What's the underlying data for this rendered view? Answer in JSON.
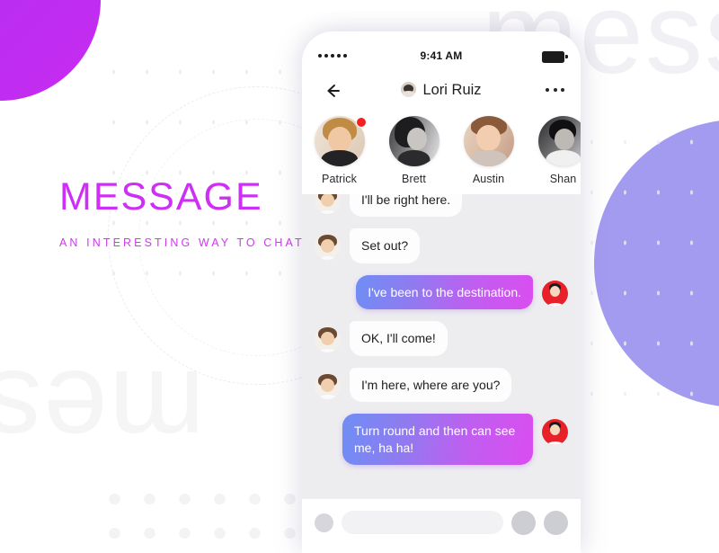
{
  "hero": {
    "title": "MESSAGE",
    "subtitle": "AN INTERESTING WAY TO CHAT",
    "title_color": "#cd2ff5",
    "subtitle_color": "#cf38ef"
  },
  "background": {
    "ghost_word_topright": "mess",
    "ghost_word_bottomleft": "mes",
    "circle_topleft_color": "#c22ff0",
    "circle_right_color": "#a39bf0"
  },
  "phone": {
    "status": {
      "time": "9:41 AM",
      "signal_icon": "signal-dots-icon",
      "battery_icon": "battery-full-icon"
    },
    "nav": {
      "back_icon": "back-arrow-icon",
      "title": "Lori Ruiz",
      "avatar_icon": "contact-avatar-icon",
      "more_icon": "more-options-icon"
    },
    "stories": [
      {
        "name": "Patrick",
        "has_badge": true
      },
      {
        "name": "Brett",
        "has_badge": false
      },
      {
        "name": "Austin",
        "has_badge": false
      },
      {
        "name": "Shan",
        "has_badge": false
      }
    ],
    "messages": [
      {
        "text": "I'll be right here.",
        "side": "in"
      },
      {
        "text": "Set out?",
        "side": "in"
      },
      {
        "text": "I've been to the destination.",
        "side": "out"
      },
      {
        "text": "OK,  I'll come!",
        "side": "in"
      },
      {
        "text": "I'm here, where are you?",
        "side": "in"
      },
      {
        "text": "Turn round and then can see me, ha ha!",
        "side": "out"
      }
    ],
    "composer": {
      "left_icon": "add-attachment-icon",
      "input_placeholder": "",
      "emoji_icon": "emoji-icon",
      "voice_icon": "voice-record-icon"
    },
    "bubble_gradient": {
      "from": "#6f8ef4",
      "to": "#da4df0"
    }
  }
}
